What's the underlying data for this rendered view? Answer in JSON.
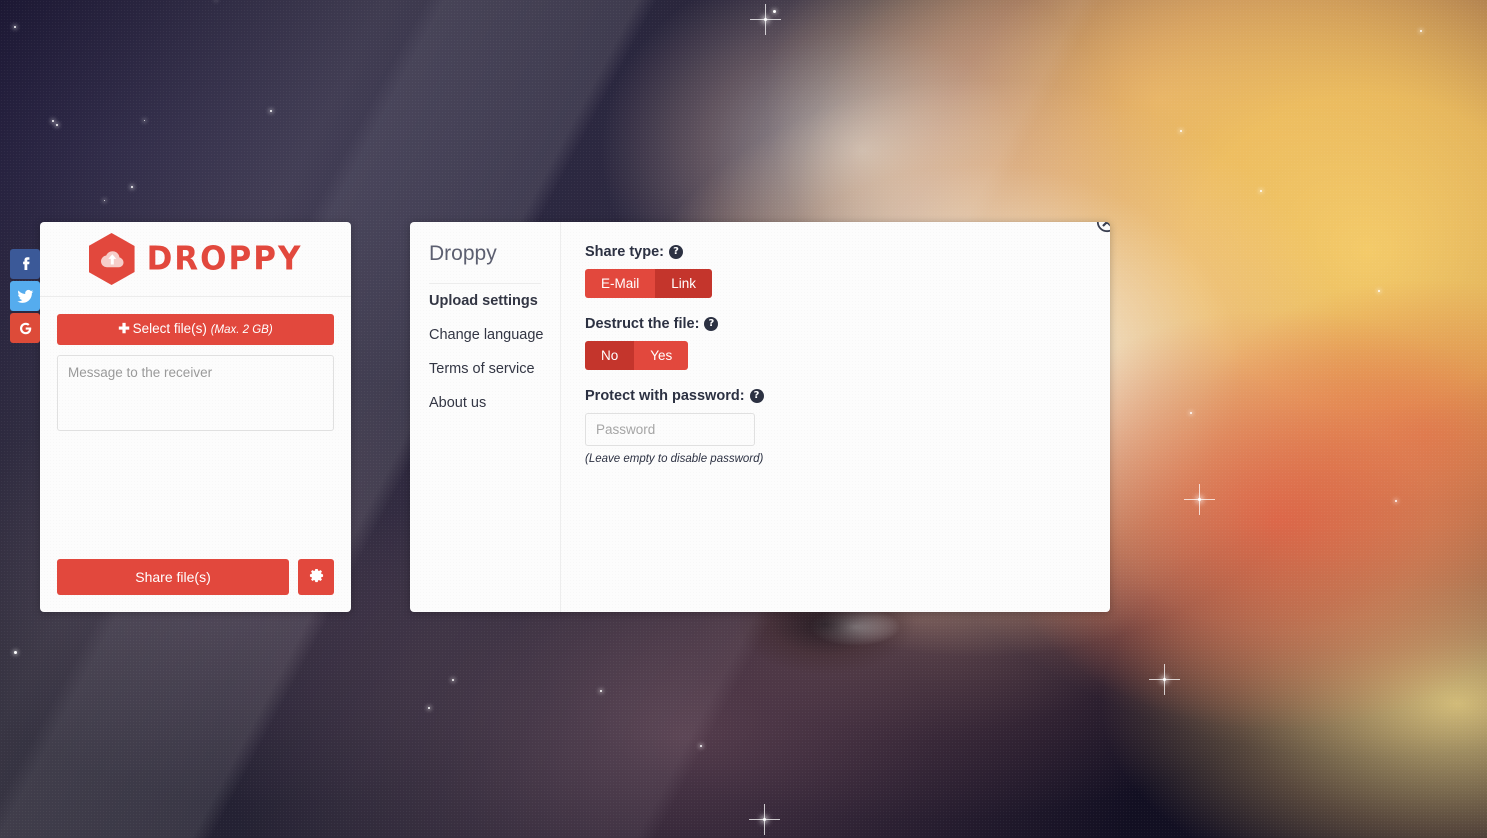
{
  "social": {
    "items": [
      {
        "name": "facebook",
        "label": "Facebook",
        "glyph": "f",
        "color": "#3b5998"
      },
      {
        "name": "twitter",
        "label": "Twitter",
        "glyph": "t",
        "color": "#55acee"
      },
      {
        "name": "google",
        "label": "Google+",
        "glyph": "G",
        "color": "#dd4b39"
      }
    ]
  },
  "upload_card": {
    "logo_text": "DROPPY",
    "logo_icon": "cloud-upload-icon",
    "select_button": {
      "icon": "plus-icon",
      "label": "Select file(s)",
      "note": "(Max. 2 GB)"
    },
    "message": {
      "value": "",
      "placeholder": "Message to the receiver"
    },
    "share_button_label": "Share file(s)",
    "settings_button_icon": "gear-icon"
  },
  "settings_modal": {
    "brand": "Droppy",
    "close_icon": "close-circle-icon",
    "nav": [
      {
        "label": "Upload settings",
        "active": true
      },
      {
        "label": "Change language",
        "active": false
      },
      {
        "label": "Terms of service",
        "active": false
      },
      {
        "label": "About us",
        "active": false
      }
    ],
    "fields": {
      "share_type": {
        "label": "Share type:",
        "help_icon": "help-icon",
        "options": [
          {
            "label": "E-Mail",
            "state": "on"
          },
          {
            "label": "Link",
            "state": "off"
          }
        ]
      },
      "destruct": {
        "label": "Destruct the file:",
        "help_icon": "help-icon",
        "options": [
          {
            "label": "No",
            "state": "off"
          },
          {
            "label": "Yes",
            "state": "on"
          }
        ]
      },
      "password": {
        "label": "Protect with password:",
        "help_icon": "help-icon",
        "value": "",
        "placeholder": "Password",
        "hint": "(Leave empty to disable password)"
      }
    }
  },
  "colors": {
    "accent": "#e2483d",
    "accent_dark": "#c4352c",
    "text_dark": "#2c3142",
    "card_bg": "#fcfcfc"
  }
}
